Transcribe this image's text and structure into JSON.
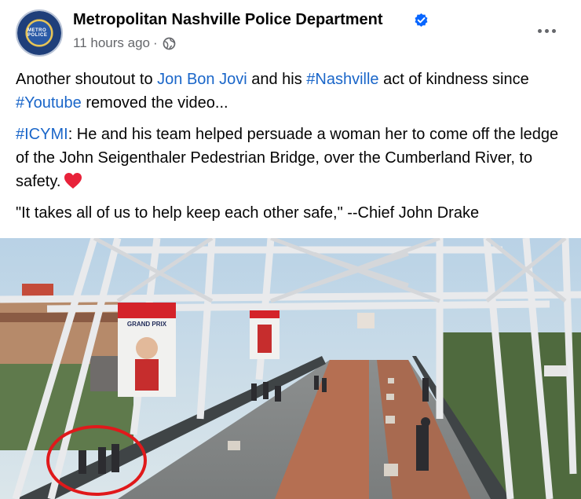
{
  "post": {
    "page_name": "Metropolitan Nashville Police Department",
    "avatar_text": "METRO POLICE",
    "timestamp": "11 hours ago",
    "separator": "·",
    "paragraph1": {
      "t1": "Another shoutout to ",
      "link1": "Jon Bon Jovi",
      "t2": " and his ",
      "link2": "#Nashville",
      "t3": " act of kindness since ",
      "link3": "#Youtube",
      "t4": " removed the video..."
    },
    "paragraph2": {
      "link1": "#ICYMI",
      "t1": ": He and his team helped persuade a woman her to come off the ledge of the John Seigenthaler Pedestrian Bridge, over the Cumberland River, to safety."
    },
    "paragraph3": "\"It takes all of us to help keep each other safe,\" --Chief John Drake"
  },
  "media": {
    "banner_text": "GRAND PRIX",
    "highlight_color": "#e0191b"
  },
  "colors": {
    "link": "#1a66c9",
    "verified": "#0866ff",
    "meta": "#65676b"
  }
}
